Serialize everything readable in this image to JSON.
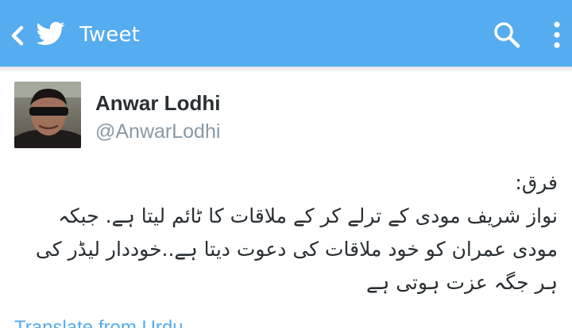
{
  "appbar": {
    "back_icon": "chevron-left-icon",
    "logo_icon": "twitter-bird-icon",
    "title": "Tweet",
    "search_icon": "search-icon",
    "overflow_icon": "overflow-menu-icon",
    "color": "#55acee"
  },
  "tweet": {
    "author": {
      "name": "Anwar Lodhi",
      "handle": "@AnwarLodhi"
    },
    "text_lines": [
      "فرق:",
      "نواز شریف مودی کے ترلے کر کے ملاقات کا ٹائم لیتا ہے. جبکہ",
      "مودی عمران کو خود ملاقات کی دعوت دیتا ہے..خوددار لیڈر کی",
      "ہر جگہ عزت ہوتی ہے"
    ],
    "translate_label": "Translate from Urdu"
  },
  "colors": {
    "brand": "#55acee",
    "text": "#292f33",
    "secondary_text": "#8899a6"
  }
}
